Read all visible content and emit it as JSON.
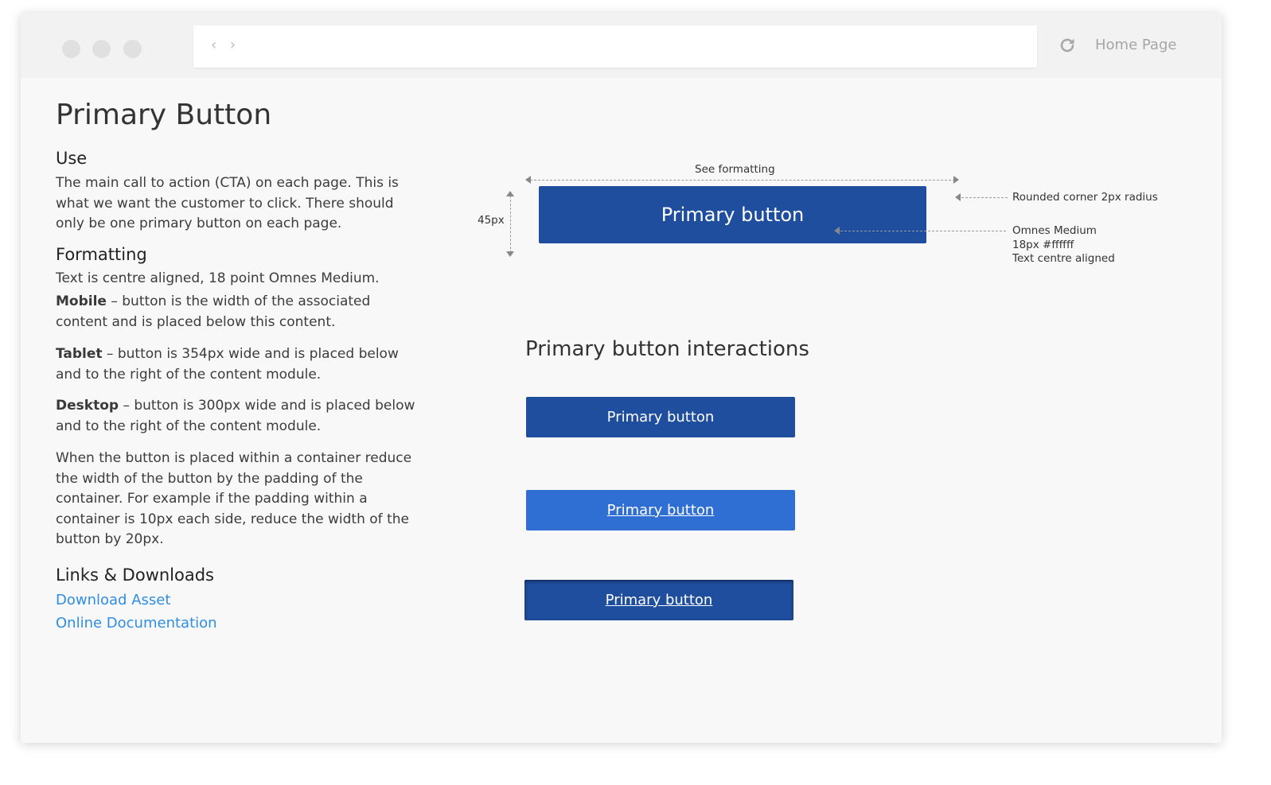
{
  "browser": {
    "home_page_label": "Home Page",
    "back_glyph": "‹",
    "forward_glyph": "›"
  },
  "page": {
    "title": "Primary Button",
    "use": {
      "heading": "Use",
      "text": "The main call to action (CTA) on each page. This is what we want the customer to click. There should only be one primary button on each page."
    },
    "formatting": {
      "heading": "Formatting",
      "intro": "Text is centre aligned, 18 point Omnes Medium.",
      "mobile_label": "Mobile",
      "mobile_text": " – button is the width of the associated content and is placed below this content.",
      "tablet_label": "Tablet",
      "tablet_text": " – button is 354px wide and is placed below and to the right of the content module.",
      "desktop_label": "Desktop",
      "desktop_text": " – button is 300px wide and is placed below and to the right of the content module.",
      "container_text": "When the button is placed within a container reduce the width of the button by the padding of the container. For example if the padding within a container is 10px each side, reduce the width of the button by 20px."
    },
    "links": {
      "heading": "Links & Downloads",
      "download": "Download Asset",
      "docs": "Online Documentation"
    }
  },
  "spec": {
    "button_label": "Primary button",
    "width_note": "See formatting",
    "height_note": "45px",
    "corner_note": "Rounded corner 2px radius",
    "font_line1": "Omnes Medium",
    "font_line2": "18px #ffffff",
    "font_line3": "Text centre aligned"
  },
  "interactions": {
    "heading": "Primary button interactions",
    "default_label": "Primary button",
    "hover_label": "Primary button",
    "active_label": "Primary button"
  },
  "colors": {
    "primary": "#1f4e9f",
    "hover": "#2f6ed2",
    "link": "#2f8de4"
  }
}
